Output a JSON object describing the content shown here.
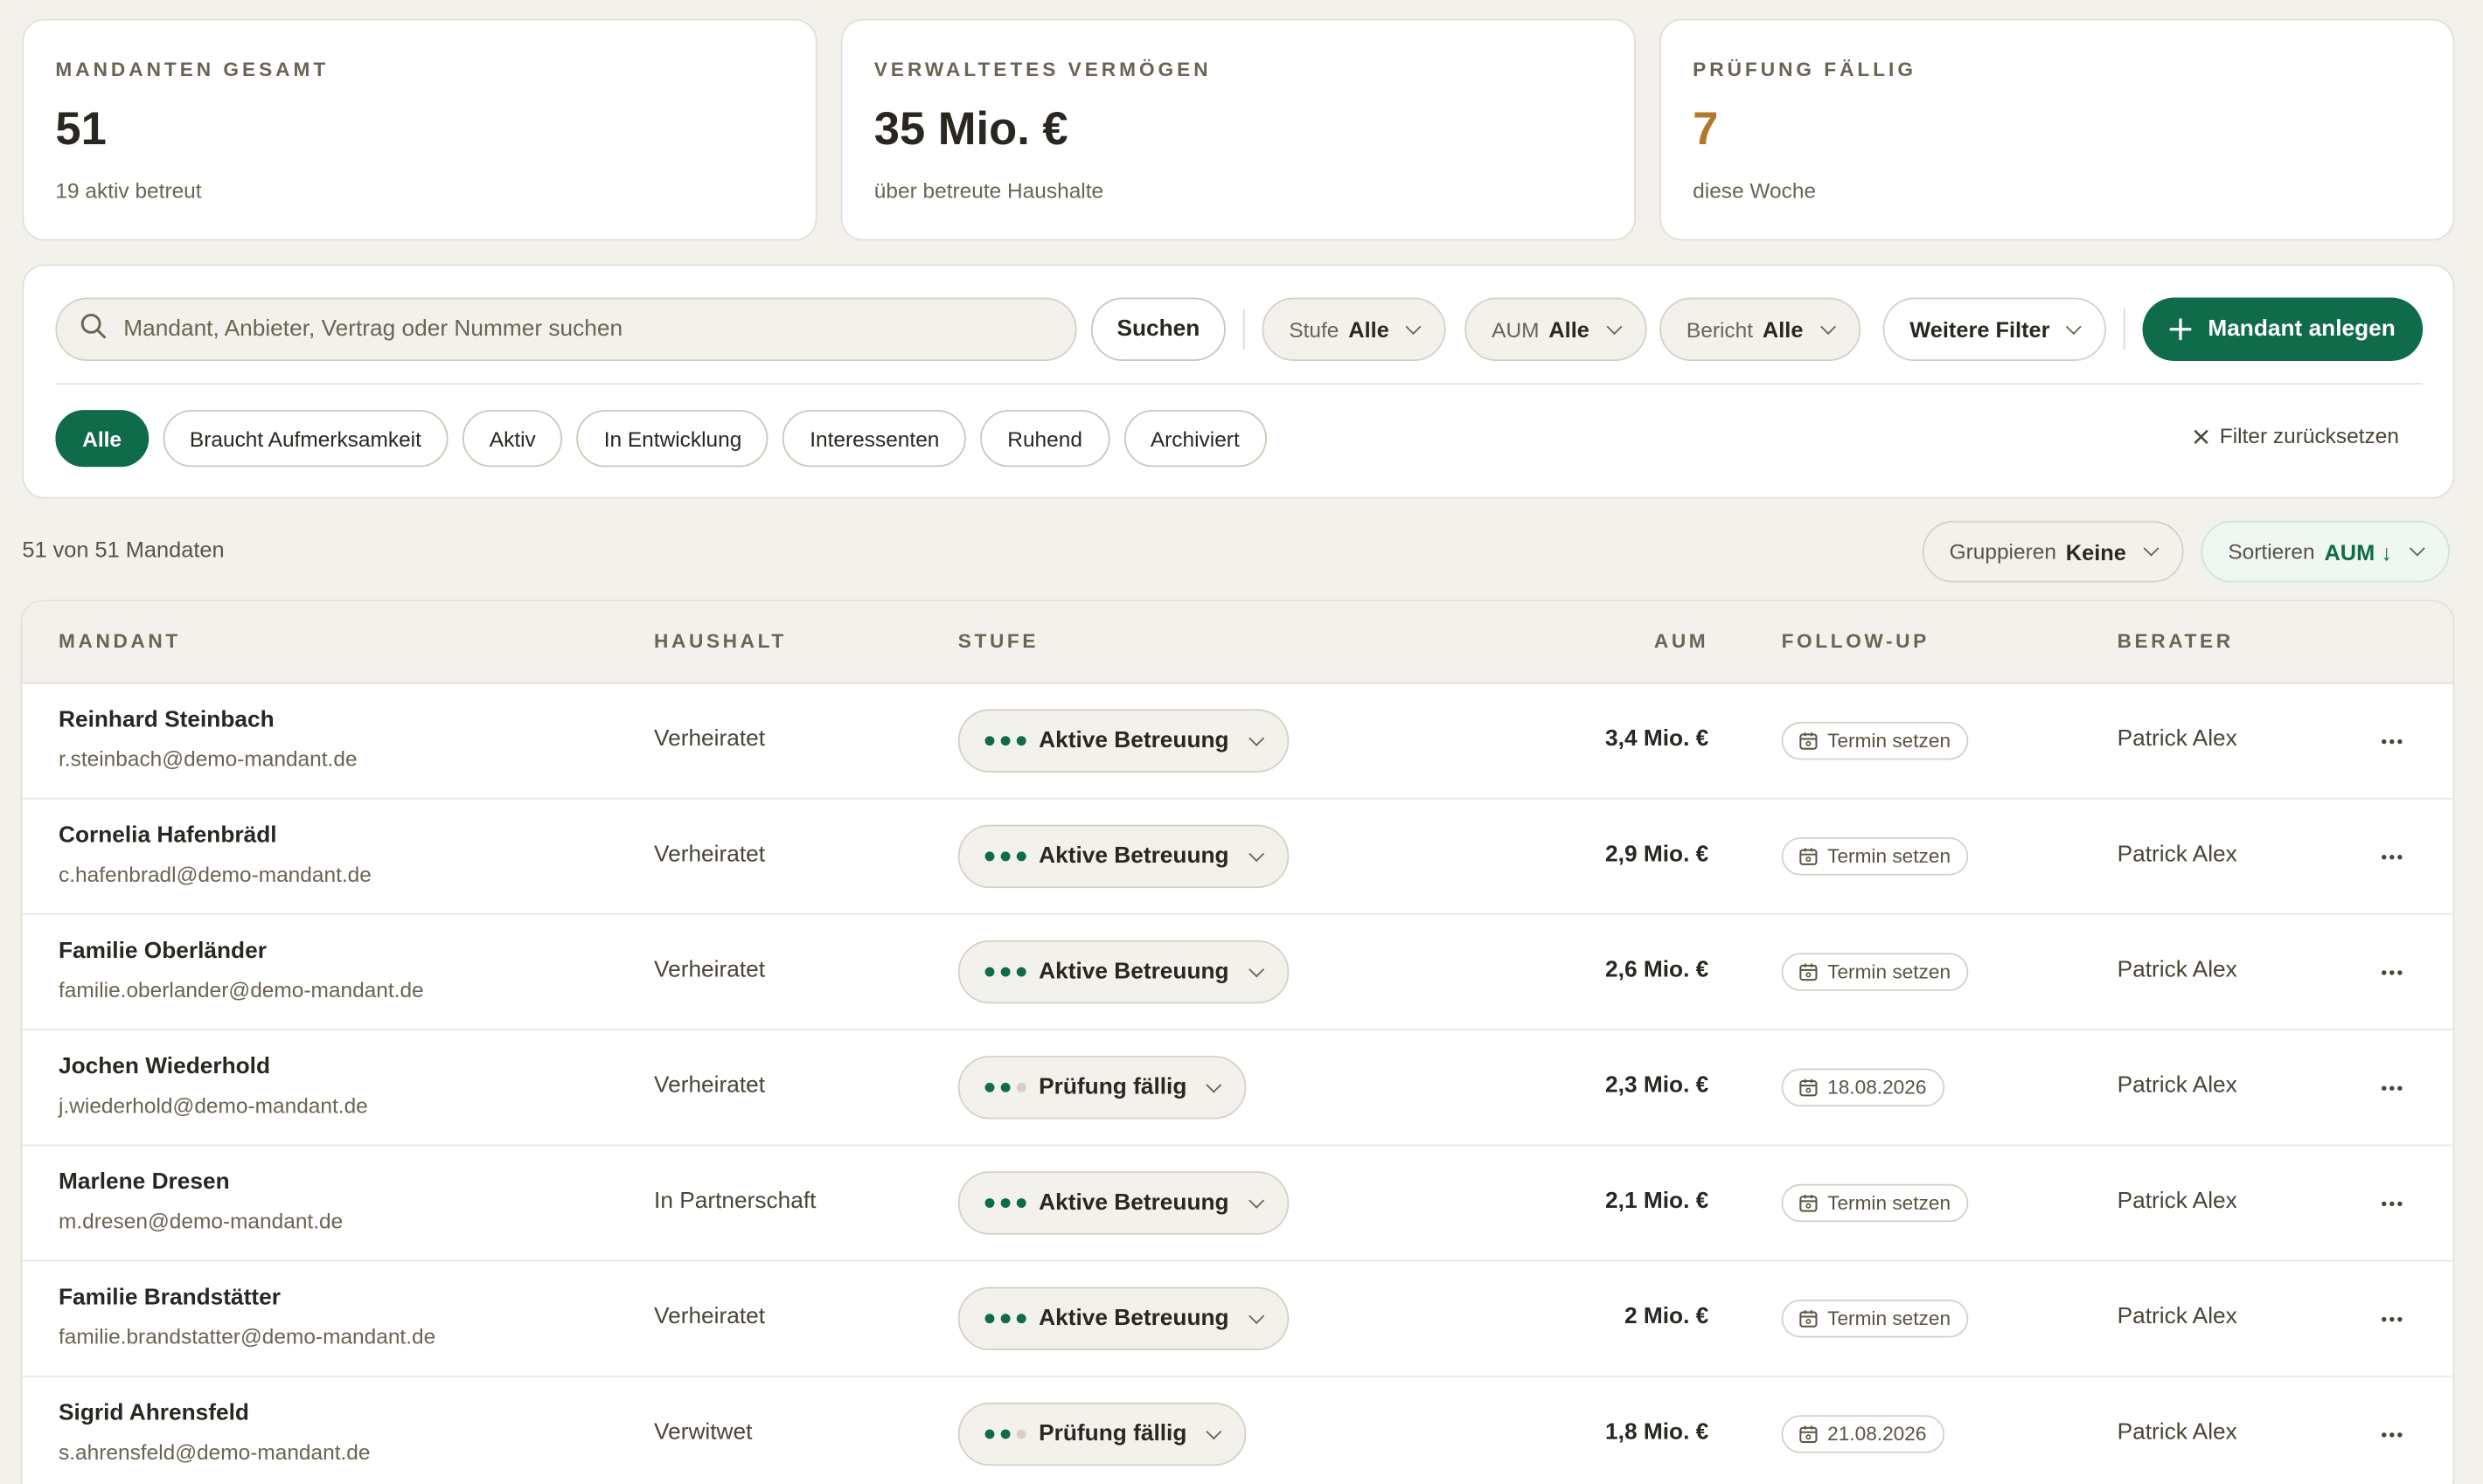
{
  "stats": [
    {
      "label": "MANDANTEN GESAMT",
      "value": "51",
      "sub": "19 aktiv betreut",
      "accent": false
    },
    {
      "label": "VERWALTETES VERMÖGEN",
      "value": "35 Mio. €",
      "sub": "über betreute Haushalte",
      "accent": false
    },
    {
      "label": "PRÜFUNG FÄLLIG",
      "value": "7",
      "sub": "diese Woche",
      "accent": true
    }
  ],
  "search": {
    "placeholder": "Mandant, Anbieter, Vertrag oder Nummer suchen",
    "button": "Suchen"
  },
  "filters": {
    "stufe": {
      "label": "Stufe",
      "value": "Alle"
    },
    "aum": {
      "label": "AUM",
      "value": "Alle"
    },
    "bericht": {
      "label": "Bericht",
      "value": "Alle"
    },
    "more": "Weitere Filter",
    "add": "Mandant anlegen",
    "reset": "Filter zurücksetzen"
  },
  "tabs": [
    "Alle",
    "Braucht Aufmerksamkeit",
    "Aktiv",
    "In Entwicklung",
    "Interessenten",
    "Ruhend",
    "Archiviert"
  ],
  "active_tab": "Alle",
  "count_text": "51 von 51 Mandaten",
  "grouping": {
    "label": "Gruppieren",
    "value": "Keine"
  },
  "sorting": {
    "label": "Sortieren",
    "value": "AUM ↓"
  },
  "table": {
    "headers": {
      "mandant": "MANDANT",
      "haushalt": "HAUSHALT",
      "stufe": "STUFE",
      "aum": "AUM",
      "followup": "FOLLOW-UP",
      "berater": "BERATER"
    },
    "rows": [
      {
        "name": "Reinhard Steinbach",
        "email": "r.steinbach@demo-mandant.de",
        "household": "Verheiratet",
        "stage": "Aktive Betreuung",
        "stage_level": 3,
        "aum": "3,4 Mio. €",
        "followup": "Termin setzen",
        "advisor": "Patrick Alex"
      },
      {
        "name": "Cornelia Hafenbrädl",
        "email": "c.hafenbradl@demo-mandant.de",
        "household": "Verheiratet",
        "stage": "Aktive Betreuung",
        "stage_level": 3,
        "aum": "2,9 Mio. €",
        "followup": "Termin setzen",
        "advisor": "Patrick Alex"
      },
      {
        "name": "Familie Oberländer",
        "email": "familie.oberlander@demo-mandant.de",
        "household": "Verheiratet",
        "stage": "Aktive Betreuung",
        "stage_level": 3,
        "aum": "2,6 Mio. €",
        "followup": "Termin setzen",
        "advisor": "Patrick Alex"
      },
      {
        "name": "Jochen Wiederhold",
        "email": "j.wiederhold@demo-mandant.de",
        "household": "Verheiratet",
        "stage": "Prüfung fällig",
        "stage_level": 2,
        "aum": "2,3 Mio. €",
        "followup": "18.08.2026",
        "advisor": "Patrick Alex"
      },
      {
        "name": "Marlene Dresen",
        "email": "m.dresen@demo-mandant.de",
        "household": "In Partnerschaft",
        "stage": "Aktive Betreuung",
        "stage_level": 3,
        "aum": "2,1 Mio. €",
        "followup": "Termin setzen",
        "advisor": "Patrick Alex"
      },
      {
        "name": "Familie Brandstätter",
        "email": "familie.brandstatter@demo-mandant.de",
        "household": "Verheiratet",
        "stage": "Aktive Betreuung",
        "stage_level": 3,
        "aum": "2 Mio. €",
        "followup": "Termin setzen",
        "advisor": "Patrick Alex"
      },
      {
        "name": "Sigrid Ahrensfeld",
        "email": "s.ahrensfeld@demo-mandant.de",
        "household": "Verwitwet",
        "stage": "Prüfung fällig",
        "stage_level": 2,
        "aum": "1,8 Mio. €",
        "followup": "21.08.2026",
        "advisor": "Patrick Alex"
      }
    ]
  },
  "colors": {
    "brand": "#0f6b4a",
    "warning": "#b07a2c",
    "background": "#f3f1ec"
  },
  "icons": [
    "search-icon",
    "plus-icon",
    "close-icon",
    "chevron-down-icon",
    "calendar-icon",
    "more-icon"
  ]
}
